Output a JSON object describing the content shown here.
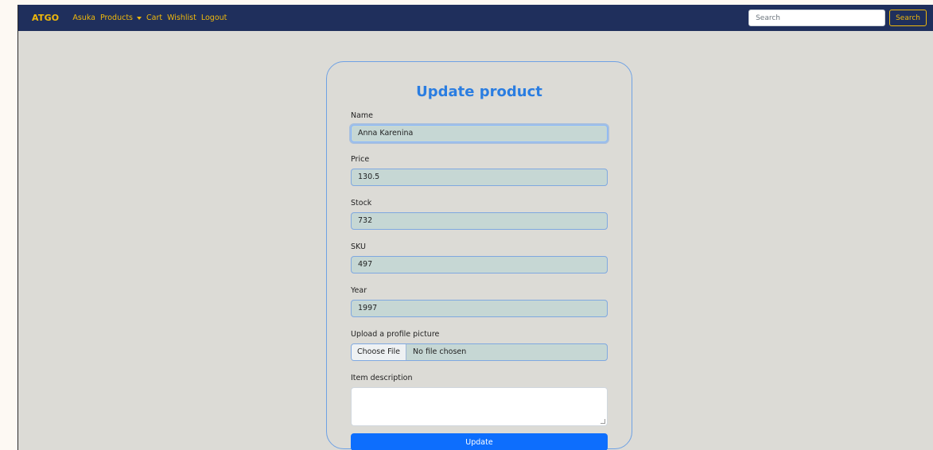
{
  "navbar": {
    "brand": "ATGO",
    "links": [
      "Asuka",
      "Products",
      "Cart",
      "Wishlist",
      "Logout"
    ],
    "search_placeholder": "Search",
    "search_button": "Search"
  },
  "form": {
    "title": "Update product",
    "fields": {
      "name": {
        "label": "Name",
        "value": "Anna Karenina"
      },
      "price": {
        "label": "Price",
        "value": "130.5"
      },
      "stock": {
        "label": "Stock",
        "value": "732"
      },
      "sku": {
        "label": "SKU",
        "value": "497"
      },
      "year": {
        "label": "Year",
        "value": "1997"
      }
    },
    "upload": {
      "label": "Upload a profile picture",
      "button": "Choose File",
      "status": "No file chosen"
    },
    "description": {
      "label": "Item description",
      "value": ""
    },
    "submit": "Update"
  },
  "colors": {
    "navbar_bg": "#1f2f5c",
    "nav_accent": "#f0b90b",
    "title_blue": "#2a7de1",
    "button_blue": "#0d6efd",
    "page_bg": "#dcdbd6"
  }
}
